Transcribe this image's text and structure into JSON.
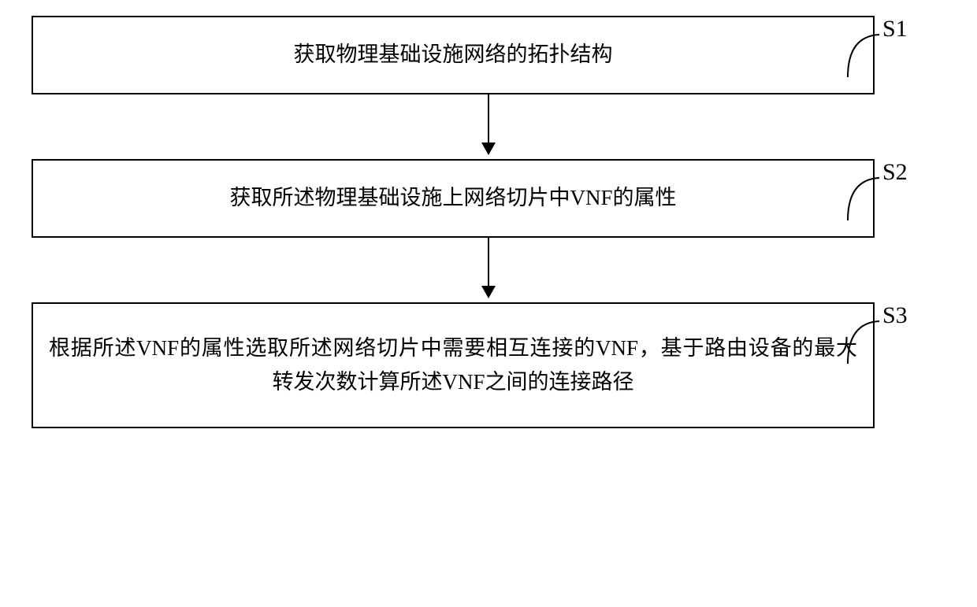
{
  "steps": [
    {
      "label": "S1",
      "text": "获取物理基础设施网络的拓扑结构"
    },
    {
      "label": "S2",
      "text": "获取所述物理基础设施上网络切片中VNF的属性"
    },
    {
      "label": "S3",
      "text": "根据所述VNF的属性选取所述网络切片中需要相互连接的VNF，基于路由设备的最大转发次数计算所述VNF之间的连接路径"
    }
  ]
}
